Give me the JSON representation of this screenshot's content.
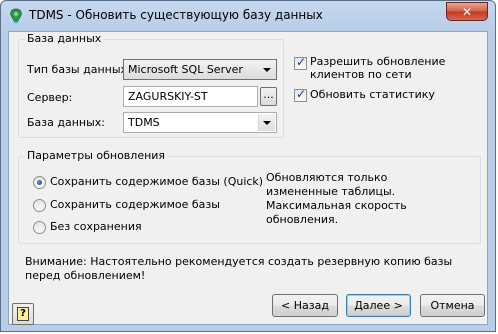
{
  "window": {
    "title": "TDMS - Обновить существующую базу данных",
    "close_glyph": "✕"
  },
  "database_group": {
    "title": "База данных",
    "db_type_label": "Тип базы данных:",
    "db_type_value": "Microsoft SQL Server",
    "server_label": "Сервер:",
    "server_value": "ZAGURSKIY-ST",
    "browse_label": "...",
    "database_label": "База данных:",
    "database_value": "TDMS"
  },
  "options": {
    "allow_clients_update": {
      "label": "Разрешить обновление клиентов по сети",
      "checked": true
    },
    "update_statistics": {
      "label": "Обновить статистику",
      "checked": true
    }
  },
  "update_params_group": {
    "title": "Параметры обновления",
    "radios": [
      {
        "label": "Сохранить содержимое базы (Quick)",
        "selected": true
      },
      {
        "label": "Сохранить содержимое базы",
        "selected": false
      },
      {
        "label": "Без сохранения",
        "selected": false
      }
    ],
    "description": "Обновляются только измененные таблицы. Максимальная скорость обновления."
  },
  "warning": "Внимание: Настоятельно рекомендуется создать резервную копию базы перед обновлением!",
  "buttons": {
    "back": "< Назад",
    "next": "Далее >",
    "cancel": "Отмена",
    "help_glyph": "?"
  },
  "icons": {
    "app": "tdms-app-icon",
    "help": "help-icon",
    "dropdown": "chevron-down-icon",
    "check": "checkmark-icon"
  },
  "colors": {
    "title_bar": "#c6d8ee",
    "client_bg": "#f0f0f0",
    "close_button": "#c03a24",
    "check_color": "#1b3d8a"
  }
}
